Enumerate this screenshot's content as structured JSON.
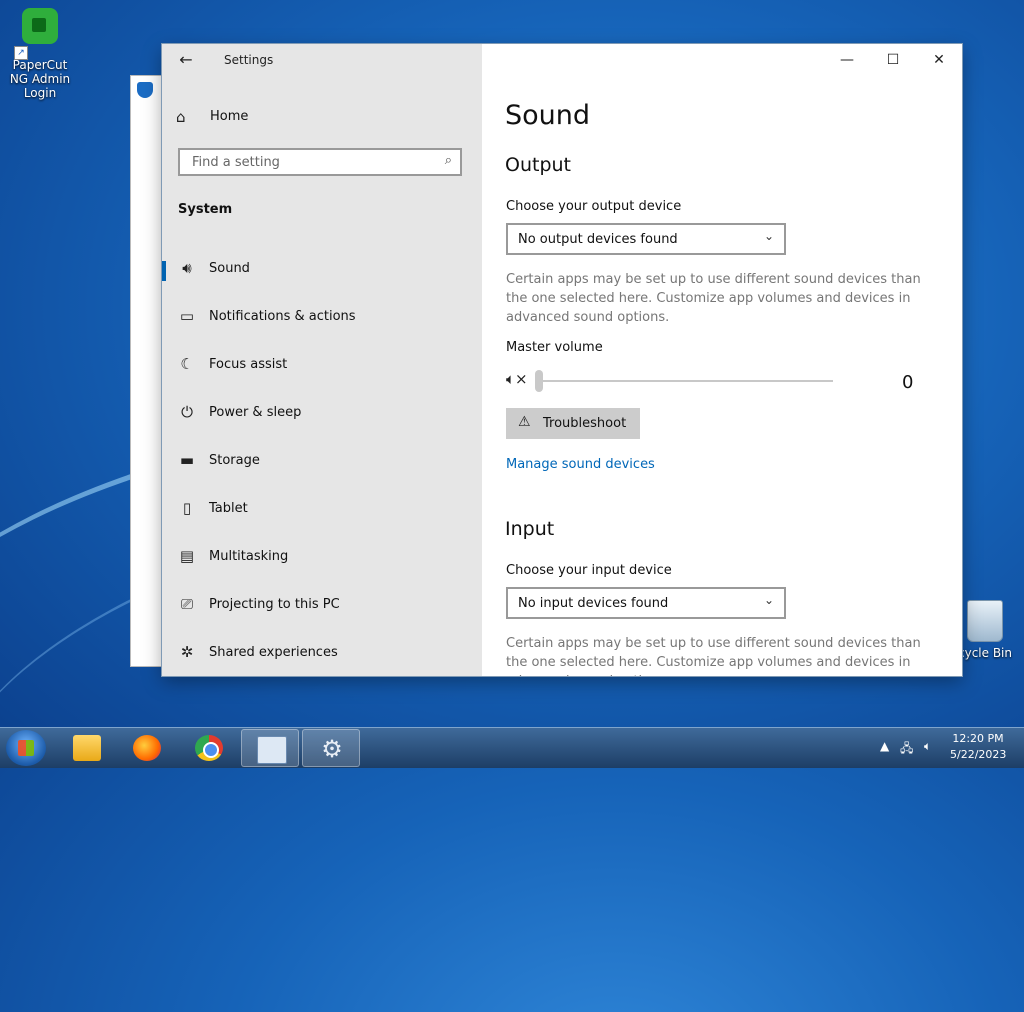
{
  "desktop": {
    "icons": [
      {
        "label": "PaperCut NG Admin Login"
      },
      {
        "label": "cycle Bin"
      }
    ]
  },
  "settings": {
    "title": "Settings",
    "home_label": "Home",
    "search_placeholder": "Find a setting",
    "section_label": "System",
    "nav_items": [
      {
        "label": "Sound",
        "icon": "speaker-icon",
        "active": true
      },
      {
        "label": "Notifications & actions",
        "icon": "notification-icon"
      },
      {
        "label": "Focus assist",
        "icon": "moon-icon"
      },
      {
        "label": "Power & sleep",
        "icon": "power-icon"
      },
      {
        "label": "Storage",
        "icon": "storage-icon"
      },
      {
        "label": "Tablet",
        "icon": "tablet-icon"
      },
      {
        "label": "Multitasking",
        "icon": "multitasking-icon"
      },
      {
        "label": "Projecting to this PC",
        "icon": "projecting-icon"
      },
      {
        "label": "Shared experiences",
        "icon": "shared-icon"
      }
    ],
    "content": {
      "page_title": "Sound",
      "output": {
        "heading": "Output",
        "choose_label": "Choose your output device",
        "device_value": "No output devices found",
        "info": "Certain apps may be set up to use different sound devices than the one selected here. Customize app volumes and devices in advanced sound options.",
        "master_volume_label": "Master volume",
        "volume_value": "0",
        "troubleshoot_label": "Troubleshoot",
        "manage_link": "Manage sound devices"
      },
      "input": {
        "heading": "Input",
        "choose_label": "Choose your input device",
        "device_value": "No input devices found",
        "info": "Certain apps may be set up to use different sound devices than the one selected here. Customize app volumes and devices in advanced sound options."
      }
    }
  },
  "taskbar": {
    "clock_time": "12:20 PM",
    "clock_date": "5/22/2023"
  },
  "colors": {
    "accent": "#0063b1",
    "link": "#0067b8",
    "nav_bg": "#e6e6e6"
  }
}
